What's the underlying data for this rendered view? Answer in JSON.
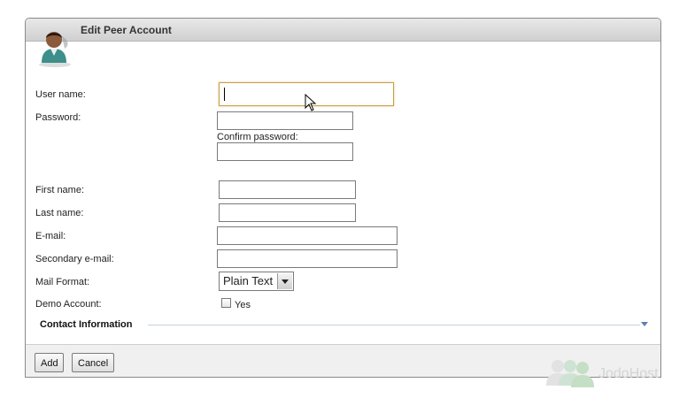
{
  "window": {
    "title": "Edit Peer Account"
  },
  "form": {
    "username_label": "User name:",
    "username_value": "",
    "password_label": "Password:",
    "confirm_password_label": "Confirm password:",
    "firstname_label": "First name:",
    "lastname_label": "Last name:",
    "email_label": "E-mail:",
    "secondary_email_label": "Secondary e-mail:",
    "mail_format_label": "Mail Format:",
    "mail_format_selected": "Plain Text",
    "demo_account_label": "Demo Account:",
    "demo_account_option": "Yes",
    "demo_account_checked": false
  },
  "section": {
    "contact_information": "Contact Information"
  },
  "footer": {
    "add_label": "Add",
    "cancel_label": "Cancel"
  },
  "watermark": {
    "text": "JodoHost"
  },
  "colors": {
    "focus_border": "#c8a04a",
    "section_accent": "#5a7fb5"
  }
}
